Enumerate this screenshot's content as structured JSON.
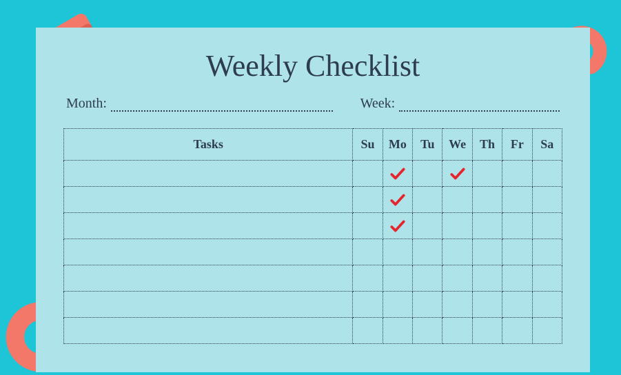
{
  "title": "Weekly Checklist",
  "month_label": "Month:",
  "week_label": "Week:",
  "tasks_header": "Tasks",
  "days": [
    "Su",
    "Mo",
    "Tu",
    "We",
    "Th",
    "Fr",
    "Sa"
  ],
  "rows": [
    {
      "task": "",
      "checks": [
        false,
        true,
        false,
        true,
        false,
        false,
        false
      ]
    },
    {
      "task": "",
      "checks": [
        false,
        true,
        false,
        false,
        false,
        false,
        false
      ]
    },
    {
      "task": "",
      "checks": [
        false,
        true,
        false,
        false,
        false,
        false,
        false
      ]
    },
    {
      "task": "",
      "checks": [
        false,
        false,
        false,
        false,
        false,
        false,
        false
      ]
    },
    {
      "task": "",
      "checks": [
        false,
        false,
        false,
        false,
        false,
        false,
        false
      ]
    },
    {
      "task": "",
      "checks": [
        false,
        false,
        false,
        false,
        false,
        false,
        false
      ]
    },
    {
      "task": "",
      "checks": [
        false,
        false,
        false,
        false,
        false,
        false,
        false
      ]
    }
  ],
  "colors": {
    "check": "#e4252b",
    "deco_fill": "#f4786a",
    "deco_shadow": "#c4493d"
  }
}
